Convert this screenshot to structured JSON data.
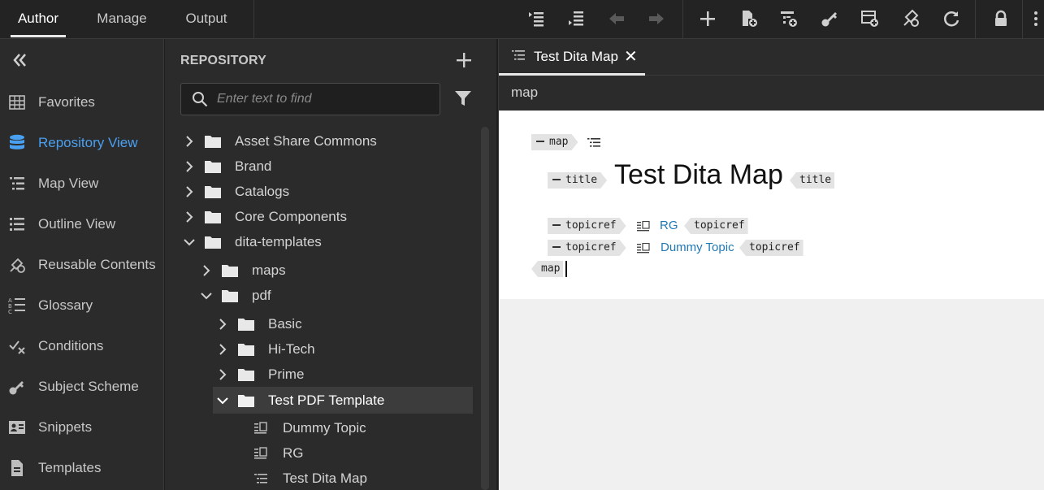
{
  "toolbar": {
    "tabs": [
      "Author",
      "Manage",
      "Output"
    ],
    "icons": [
      "insert-before-icon",
      "insert-after-icon",
      "move-left-icon",
      "move-right-icon",
      "add-icon",
      "new-topic-icon",
      "new-map-icon",
      "key-icon",
      "table-add-icon",
      "reuse-icon",
      "refresh-icon",
      "lock-icon"
    ]
  },
  "leftnav": {
    "collapse_icon": "double-chevron-left-icon",
    "items": [
      {
        "label": "Favorites",
        "icon": "grid-icon"
      },
      {
        "label": "Repository View",
        "icon": "database-icon",
        "active": true
      },
      {
        "label": "Map View",
        "icon": "map-list-icon"
      },
      {
        "label": "Outline View",
        "icon": "outline-list-icon"
      },
      {
        "label": "Reusable Contents",
        "icon": "reuse-icon"
      },
      {
        "label": "Glossary",
        "icon": "glossary-icon"
      },
      {
        "label": "Conditions",
        "icon": "conditions-icon"
      },
      {
        "label": "Subject Scheme",
        "icon": "key-icon"
      },
      {
        "label": "Snippets",
        "icon": "snippet-icon"
      },
      {
        "label": "Templates",
        "icon": "template-icon"
      }
    ]
  },
  "repository": {
    "title": "REPOSITORY",
    "search_placeholder": "Enter text to find",
    "tree": [
      {
        "label": "Asset Share Commons",
        "type": "folder",
        "expanded": false
      },
      {
        "label": "Brand",
        "type": "folder",
        "expanded": false
      },
      {
        "label": "Catalogs",
        "type": "folder",
        "expanded": false
      },
      {
        "label": "Core Components",
        "type": "folder",
        "expanded": false
      },
      {
        "label": "dita-templates",
        "type": "folder",
        "expanded": true
      },
      {
        "label": "maps",
        "type": "folder",
        "expanded": false
      },
      {
        "label": "pdf",
        "type": "folder",
        "expanded": true
      },
      {
        "label": "Basic",
        "type": "folder",
        "expanded": false
      },
      {
        "label": "Hi-Tech",
        "type": "folder",
        "expanded": false
      },
      {
        "label": "Prime",
        "type": "folder",
        "expanded": false
      },
      {
        "label": "Test PDF Template",
        "type": "folder",
        "expanded": true,
        "selected": true
      },
      {
        "label": "Dummy Topic",
        "type": "topic"
      },
      {
        "label": "RG",
        "type": "topic"
      },
      {
        "label": "Test Dita Map",
        "type": "map"
      }
    ]
  },
  "editor": {
    "tab_label": "Test Dita Map",
    "tab_close": "✕",
    "breadcrumb": "map",
    "content": {
      "map_open": "map",
      "title_open": "title",
      "title_text": "Test Dita Map",
      "title_close": "title",
      "topicrefs": [
        {
          "open": "topicref",
          "link": "RG",
          "close": "topicref"
        },
        {
          "open": "topicref",
          "link": "Dummy Topic",
          "close": "topicref"
        }
      ],
      "map_close": "map"
    }
  }
}
